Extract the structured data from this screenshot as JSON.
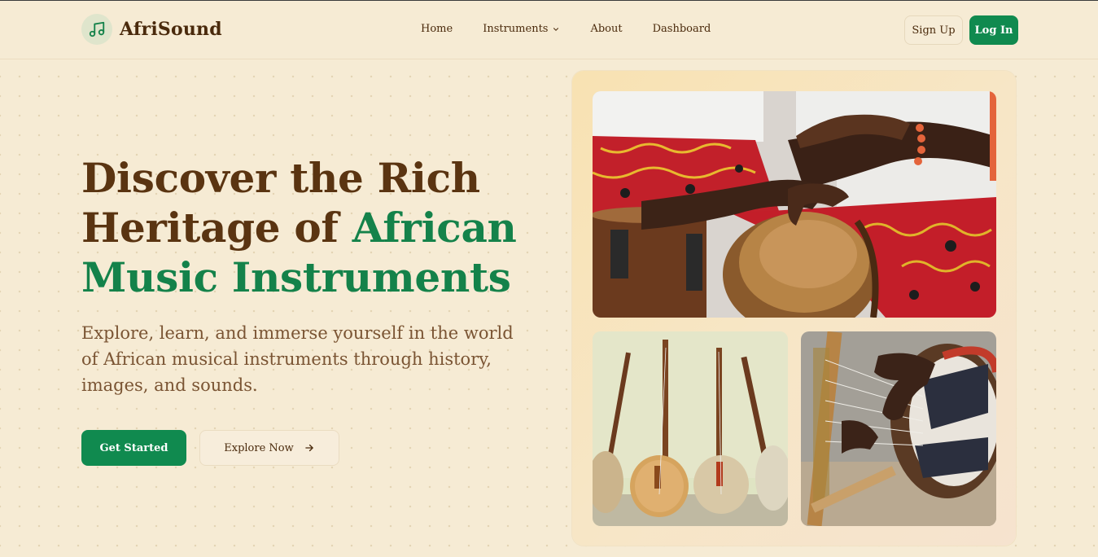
{
  "brand": {
    "name": "AfriSound",
    "icon": "music-note-icon"
  },
  "nav": {
    "items": [
      {
        "label": "Home"
      },
      {
        "label": "Instruments",
        "has_dropdown": true
      },
      {
        "label": "About"
      },
      {
        "label": "Dashboard"
      }
    ]
  },
  "auth": {
    "signup_label": "Sign Up",
    "login_label": "Log In"
  },
  "hero": {
    "title_part1": "Discover the Rich Heritage of ",
    "title_accent": "African Music Instruments",
    "subtitle": "Explore, learn, and immerse yourself in the world of African musical instruments through history, images, and sounds.",
    "primary_cta": "Get Started",
    "secondary_cta": "Explore Now"
  },
  "gallery": {
    "images": [
      {
        "subject": "drummers-playing-djembe"
      },
      {
        "subject": "koras-against-wall"
      },
      {
        "subject": "hands-playing-kora"
      }
    ]
  },
  "colors": {
    "background": "#f6ebd4",
    "brand_green": "#108a4f",
    "heading_brown": "#5a3411",
    "body_brown": "#7a5433"
  }
}
